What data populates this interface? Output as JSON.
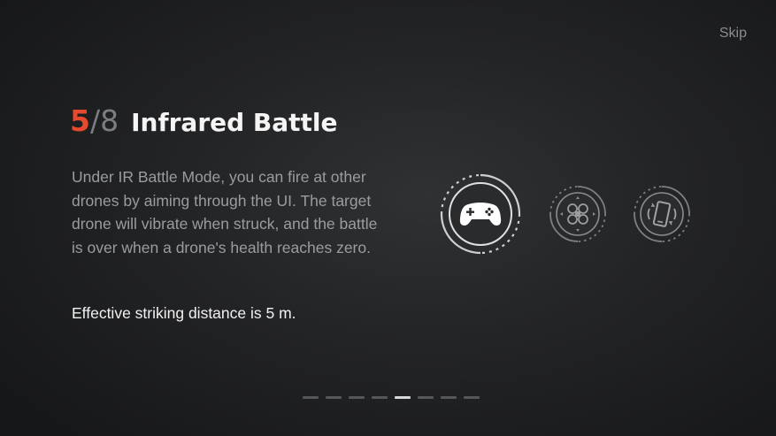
{
  "header": {
    "skip_label": "Skip"
  },
  "step": {
    "current": "5",
    "slash": "/",
    "total": "8"
  },
  "title": "Infrared Battle",
  "description": "Under IR Battle Mode, you can fire at other drones by aiming through the UI. The target drone will vibrate when struck, and the battle is over when a drone's health reaches zero.",
  "note": "Effective striking distance is 5 m.",
  "icons": [
    {
      "name": "gamepad-icon",
      "selected": true
    },
    {
      "name": "drone-icon",
      "selected": false
    },
    {
      "name": "vibrate-phone-icon",
      "selected": false
    }
  ],
  "pagination": {
    "total": 8,
    "active_index": 4
  },
  "colors": {
    "accent": "#e64a2e",
    "background": "#232426",
    "muted_text": "#9a9c9f"
  }
}
